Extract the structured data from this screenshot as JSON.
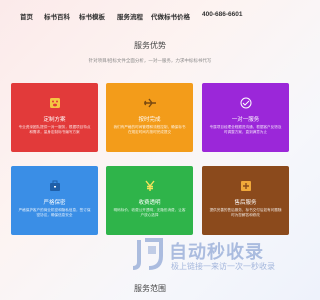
{
  "nav": {
    "items": [
      "首页",
      "标书百科",
      "标书模板",
      "服务流程",
      "代做标书价格"
    ],
    "phone": "400-686-6601"
  },
  "services": {
    "title": "服务优势",
    "subtitle": "针对项目/招标文件全面分析，一对一服务，力求中标标书代写",
    "cards": [
      {
        "title": "定制方案",
        "desc": "专业资深团队提供一对一服务，根据项目特点和需求，量身定制标书编写方案",
        "color": "#e23a3a",
        "icon": "paw-icon"
      },
      {
        "title": "按时完成",
        "desc": "我们有严格的时间管理和流程控制，确保标书在规定时间内按时完成提交",
        "color": "#f39c1a",
        "icon": "airplane-icon"
      },
      {
        "title": "一对一服务",
        "desc": "专属项目经理全程跟进沟通，根据客户反馈及时调整方案，直到满意为止",
        "color": "#9b27d9",
        "icon": "handshake-icon"
      },
      {
        "title": "严格保密",
        "desc": "严格保护客户的商业机密和隐私信息，签订保密协议，确保信息安全",
        "color": "#3a8ee6",
        "icon": "briefcase-icon"
      },
      {
        "title": "收费透明",
        "desc": "明码标价，收费公开透明，无隐形消费，让客户放心选择",
        "color": "#2fb44a",
        "icon": "yen-icon"
      },
      {
        "title": "售后服务",
        "desc": "提供完善的售后服务，标书交付后如有问题随时为您解答和修改",
        "color": "#8b4a1c",
        "icon": "plus-box-icon"
      }
    ]
  },
  "scope": {
    "title": "服务范围"
  },
  "watermark": {
    "brand": "自动秒收录",
    "tagline": "极上链接一来访一次一秒收录"
  }
}
